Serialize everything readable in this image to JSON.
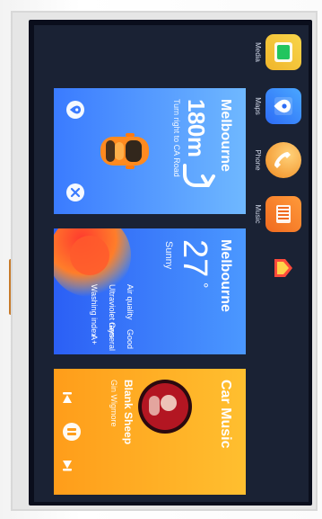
{
  "apps": [
    {
      "label": "Media",
      "icon": "media-icon",
      "color": "#f4c23a"
    },
    {
      "label": "Maps",
      "icon": "maps-icon",
      "color": "#3aa7f4"
    },
    {
      "label": "Phone",
      "icon": "phone-icon",
      "color": "#f29a2f"
    },
    {
      "label": "Music",
      "icon": "music-icon",
      "color": "#f07a2a"
    },
    {
      "label": "",
      "icon": "home-icon",
      "color": "#ff4a3a"
    }
  ],
  "navigation": {
    "city": "Melbourne",
    "distance": "180m",
    "instruction": "Turn right to CA Road"
  },
  "weather": {
    "city": "Melbourne",
    "temperature": "27",
    "unit": "°",
    "condition": "Sunny",
    "rows": [
      {
        "label": "Air quality",
        "value": "Good"
      },
      {
        "label": "Ultraviolet rays",
        "value": "General"
      },
      {
        "label": "Washing index",
        "value": "A+"
      }
    ]
  },
  "music": {
    "header": "Car Music",
    "track": "Blank Sheep",
    "artist": "Gin Wigmore"
  },
  "colors": {
    "bg": "#1a2234",
    "nav_card": "#4aa7ff",
    "weather_card": "#3b82f6",
    "music_card": "#ffb21a"
  }
}
